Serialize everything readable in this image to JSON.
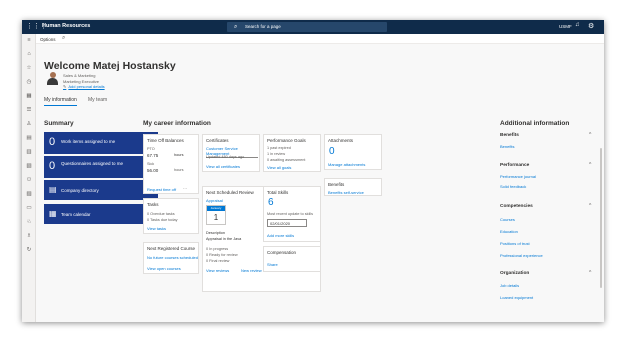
{
  "topbar": {
    "app_name": "Human Resources",
    "search_placeholder": "Search for a page",
    "company": "USMF"
  },
  "actionbar": {
    "options_label": "Options"
  },
  "header": {
    "welcome": "Welcome Matej Hostansky",
    "department": "Sales & Marketing",
    "job_title": "Marketing Executive",
    "add_personal": "Add personal details"
  },
  "tabs": {
    "my_information": "My information",
    "my_team": "My team"
  },
  "summary": {
    "title": "Summary",
    "tiles": [
      {
        "count": "0",
        "label": "Work items assigned to me"
      },
      {
        "count": "0",
        "label": "Questionnaires assigned to me"
      },
      {
        "label": "Company directory"
      },
      {
        "label": "Team calendar"
      }
    ]
  },
  "career": {
    "title": "My career information",
    "time_off": {
      "title": "Time Off Balances",
      "row1_name": "PTO",
      "row1_value": "67.75",
      "row1_unit": "hours",
      "row2_name": "Sick",
      "row2_value": "56.00",
      "row2_unit": "hours",
      "request_link": "Request time off",
      "more": "···"
    },
    "certificates": {
      "title": "Certificates",
      "item": "Customer Service Management",
      "updated": "Updated 480 days ago",
      "view_all": "View all certificates"
    },
    "performance": {
      "title": "Performance Goals",
      "line1": "1 past expired",
      "line2": "1 in review",
      "line3": "0 awaiting assessment",
      "view_all": "View all goals"
    },
    "attachments": {
      "title": "Attachments",
      "count": "0",
      "manage": "Manage attachments"
    },
    "benefits_card": {
      "title": "Benefits",
      "self_service": "Benefits self-service"
    },
    "tasks": {
      "title": "Tasks",
      "line1": "0 Overdue tasks",
      "line2": "0 Tasks due today",
      "view": "View tasks"
    },
    "next_review": {
      "title": "Next Scheduled Review",
      "status": "Appraisal",
      "month": "January",
      "day": "1",
      "description_label": "Description",
      "description": "Appraisal in the Java",
      "line1": "0 In progress",
      "line2": "0 Ready for review",
      "line3": "0 Final review",
      "view_reviews": "View reviews",
      "new_review": "New review",
      "more": "···"
    },
    "total_skills": {
      "title": "Total Skills",
      "count": "6",
      "reminder": "Most recent update to skills",
      "date": "02/01/2020",
      "add": "Add more skills"
    },
    "next_course": {
      "title": "Next Registered Course",
      "message": "No future courses scheduled",
      "view": "View open courses"
    },
    "compensation": {
      "title": "Compensation",
      "share": "Share"
    }
  },
  "additional": {
    "title": "Additional information",
    "sections": [
      {
        "heading": "Benefits",
        "links": [
          "Benefits"
        ]
      },
      {
        "heading": "Performance",
        "links": [
          "Performance journal",
          "Solid feedback"
        ]
      },
      {
        "heading": "Competencies",
        "links": [
          "Courses",
          "Education",
          "Positions of trust",
          "Professional experience"
        ]
      },
      {
        "heading": "Organization",
        "links": [
          "Job details",
          "Loaned equipment"
        ]
      }
    ]
  }
}
